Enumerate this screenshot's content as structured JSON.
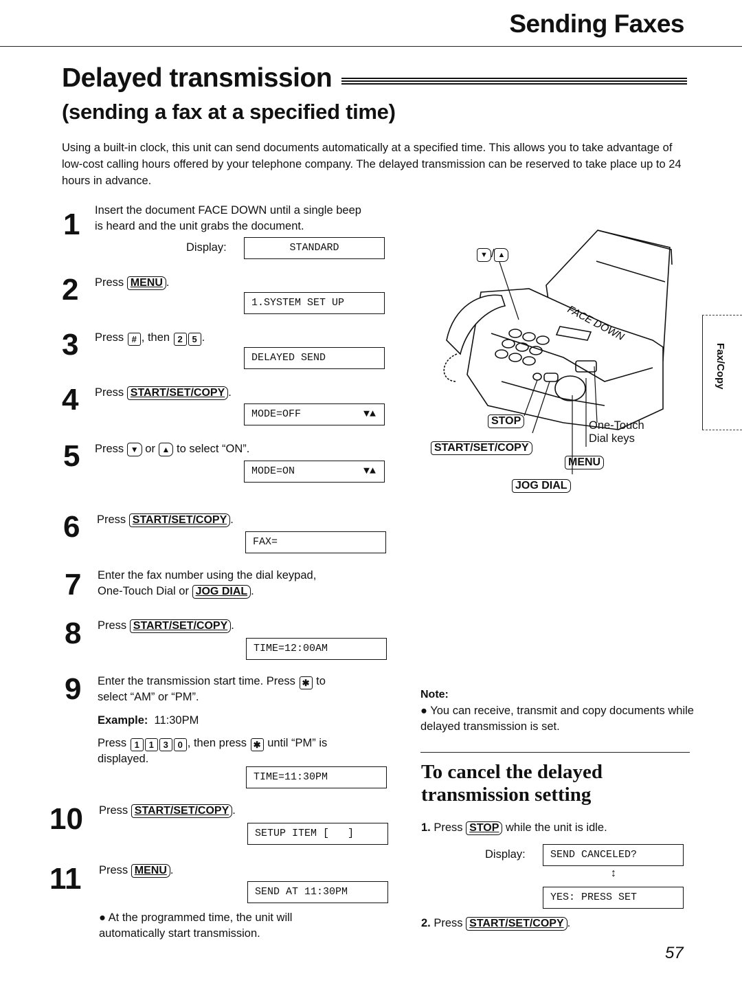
{
  "header": {
    "section_title": "Sending Faxes",
    "page_title": "Delayed transmission",
    "subtitle": "(sending a fax at a specified time)",
    "intro": "Using a built-in clock, this unit can send documents automatically at a specified time. This allows you to take advantage of low-cost calling hours offered by your telephone company. The delayed transmission can be reserved to take place up to 24 hours in advance."
  },
  "steps": [
    {
      "num": "1",
      "text": "Insert the document FACE DOWN until a single beep is heard and the unit grabs the document.",
      "display_label": "Display:",
      "display": "STANDARD"
    },
    {
      "num": "2",
      "press": "Press",
      "key": "MENU",
      "display": "1.SYSTEM SET UP"
    },
    {
      "num": "3",
      "press": "Press",
      "key1": "#",
      "then": ", then",
      "key2": "2",
      "key3": "5",
      "display": "DELAYED SEND"
    },
    {
      "num": "4",
      "press": "Press",
      "key": "START/SET/COPY",
      "display": "MODE=OFF",
      "display_arrows": "▼▲"
    },
    {
      "num": "5",
      "press": "Press",
      "key1": "▼",
      "or": "or",
      "key2": "▲",
      "suffix": "to select “ON”.",
      "display": "MODE=ON",
      "display_arrows": "▼▲"
    },
    {
      "num": "6",
      "press": "Press",
      "key": "START/SET/COPY",
      "display": "FAX="
    },
    {
      "num": "7",
      "text1": "Enter the fax number using the dial keypad,",
      "text2": "One-Touch Dial or",
      "key": "JOG DIAL"
    },
    {
      "num": "8",
      "press": "Press",
      "key": "START/SET/COPY",
      "display": "TIME=12:00AM"
    },
    {
      "num": "9",
      "text1": "Enter the transmission start time. Press",
      "key_star": "✱",
      "text1b": "to",
      "text2": "select “AM” or “PM”.",
      "example_label": "Example:",
      "example_value": "11:30PM",
      "press": "Press",
      "keys": [
        "1",
        "1",
        "3",
        "0"
      ],
      "then_press": ", then press",
      "until": "until “PM” is",
      "displayed": "displayed.",
      "display": "TIME=11:30PM"
    },
    {
      "num": "10",
      "press": "Press",
      "key": "START/SET/COPY",
      "display": "SETUP ITEM [   ]"
    },
    {
      "num": "11",
      "press": "Press",
      "key": "MENU",
      "display": "SEND AT 11:30PM",
      "bullet": "At the programmed time, the unit will automatically start transmission."
    }
  ],
  "illustration": {
    "arrow_keys_label": "▼ / ▲",
    "paper_label": "FACE DOWN",
    "stop": "STOP",
    "start": "START/SET/COPY",
    "one_touch": "One-Touch",
    "dial_keys": "Dial keys",
    "menu": "MENU",
    "jog_dial": "JOG DIAL"
  },
  "side_tab": "Fax/Copy",
  "note": {
    "heading": "Note:",
    "bullet": "You can receive, transmit and copy documents while delayed transmission is set."
  },
  "cancel": {
    "title": "To cancel the delayed transmission setting",
    "step1_num": "1.",
    "step1_press": "Press",
    "step1_key": "STOP",
    "step1_suffix": "while the unit is idle.",
    "display_label": "Display:",
    "display1": "SEND CANCELED?",
    "toggle_arrow": "↕",
    "display2": "YES: PRESS SET",
    "step2_num": "2.",
    "step2_press": "Press",
    "step2_key": "START/SET/COPY"
  },
  "page_number": "57"
}
